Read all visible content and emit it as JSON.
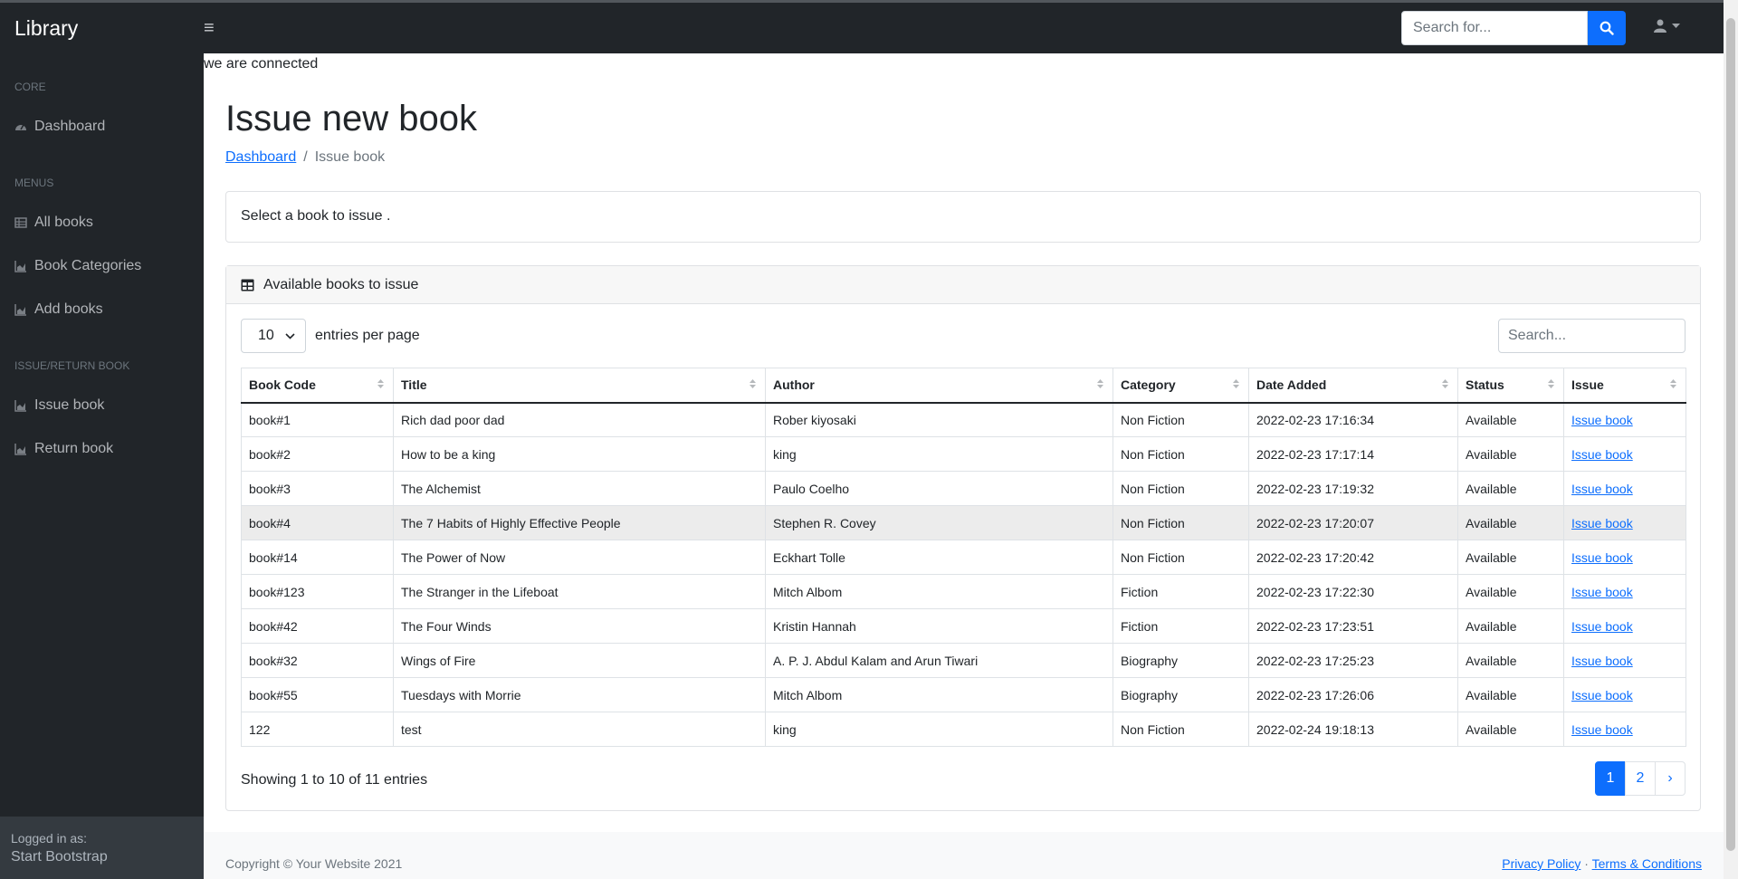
{
  "topbar": {
    "brand": "Library",
    "search_placeholder": "Search for..."
  },
  "sidebar": {
    "core_heading": "Core",
    "dashboard": "Dashboard",
    "menus_heading": "Menus",
    "all_books": "All books",
    "book_categories": "Book Categories",
    "add_books": "Add books",
    "issue_heading": "Issue/Return book",
    "issue_book": "Issue book",
    "return_book": "Return book",
    "logged_in_as": "Logged in as:",
    "user": "Start Bootstrap"
  },
  "main": {
    "connected": "we are connected",
    "title": "Issue new book",
    "breadcrumb": {
      "home": "Dashboard",
      "sep": "/",
      "current": "Issue book"
    },
    "notice": "Select a book to issue .",
    "card_title": "Available books to issue",
    "entries_value": "10",
    "entries_label": "entries per page",
    "search_placeholder": "Search...",
    "info": "Showing 1 to 10 of 11 entries"
  },
  "table": {
    "headers": [
      "Book Code",
      "Title",
      "Author",
      "Category",
      "Date Added",
      "Status",
      "Issue"
    ],
    "rows": [
      [
        "book#1",
        "Rich dad poor dad",
        "Rober kiyosaki",
        "Non Fiction",
        "2022-02-23 17:16:34",
        "Available",
        "Issue book"
      ],
      [
        "book#2",
        "How to be a king",
        "king",
        "Non Fiction",
        "2022-02-23 17:17:14",
        "Available",
        "Issue book"
      ],
      [
        "book#3",
        "The Alchemist",
        "Paulo Coelho",
        "Non Fiction",
        "2022-02-23 17:19:32",
        "Available",
        "Issue book"
      ],
      [
        "book#4",
        "The 7 Habits of Highly Effective People",
        "Stephen R. Covey",
        "Non Fiction",
        "2022-02-23 17:20:07",
        "Available",
        "Issue book"
      ],
      [
        "book#14",
        "The Power of Now",
        "Eckhart Tolle",
        "Non Fiction",
        "2022-02-23 17:20:42",
        "Available",
        "Issue book"
      ],
      [
        "book#123",
        "The Stranger in the Lifeboat",
        "Mitch Albom",
        "Fiction",
        "2022-02-23 17:22:30",
        "Available",
        "Issue book"
      ],
      [
        "book#42",
        "The Four Winds",
        "Kristin Hannah",
        "Fiction",
        "2022-02-23 17:23:51",
        "Available",
        "Issue book"
      ],
      [
        "book#32",
        "Wings of Fire",
        "A. P. J. Abdul Kalam and Arun Tiwari",
        "Biography",
        "2022-02-23 17:25:23",
        "Available",
        "Issue book"
      ],
      [
        "book#55",
        "Tuesdays with Morrie",
        "Mitch Albom",
        "Biography",
        "2022-02-23 17:26:06",
        "Available",
        "Issue book"
      ],
      [
        "122",
        "test",
        "king",
        "Non Fiction",
        "2022-02-24 19:18:13",
        "Available",
        "Issue book"
      ]
    ]
  },
  "pagination": {
    "pages": [
      "1",
      "2"
    ],
    "next": "›"
  },
  "footer": {
    "copyright": "Copyright © Your Website 2021",
    "privacy": "Privacy Policy",
    "dot": "·",
    "terms": "Terms & Conditions"
  },
  "colors": {
    "dark": "#212529",
    "primary": "#0d6efd",
    "sidebar_footer": "#343a40"
  }
}
